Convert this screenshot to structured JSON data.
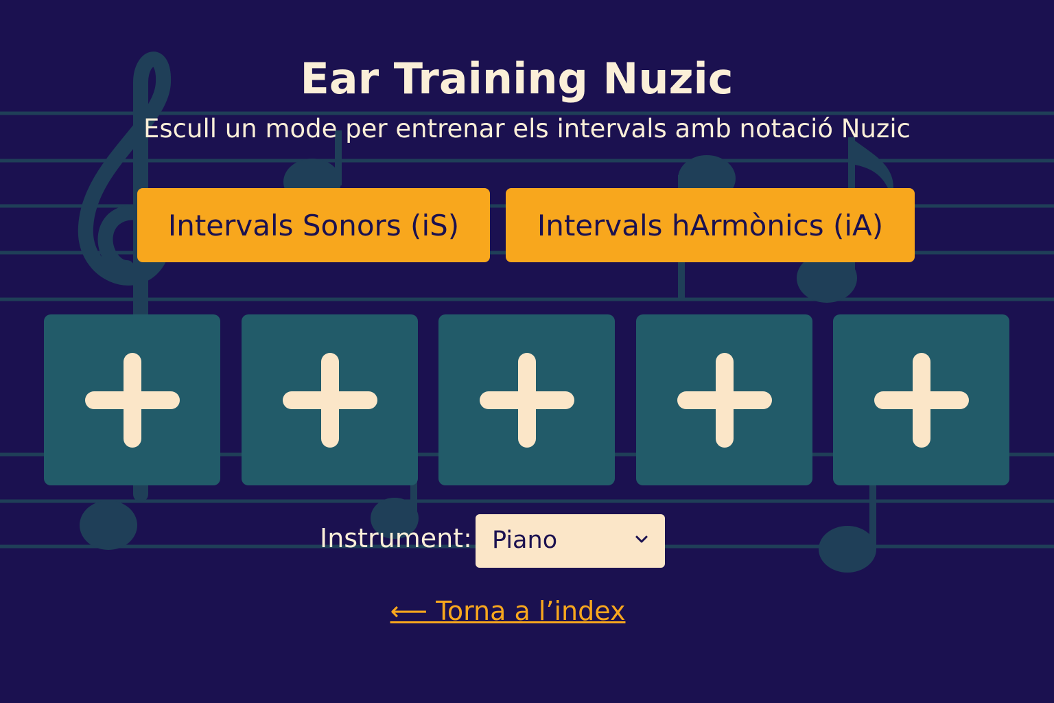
{
  "header": {
    "title": "Ear Training Nuzic",
    "subtitle": "Escull un mode per entrenar els intervals amb notació Nuzic"
  },
  "modes": [
    {
      "label": "Intervals Sonors (iS)"
    },
    {
      "label": "Intervals hArmònics (iA)"
    }
  ],
  "cards": [
    {
      "icon": "plus-icon"
    },
    {
      "icon": "plus-icon"
    },
    {
      "icon": "plus-icon"
    },
    {
      "icon": "plus-icon"
    },
    {
      "icon": "plus-icon"
    }
  ],
  "instrument": {
    "label": "Instrument:",
    "selected": "Piano"
  },
  "nav": {
    "back_label": "⟵ Torna a l’index"
  },
  "colors": {
    "background": "#1b1150",
    "accent": "#f8a71d",
    "card": "#225b69",
    "text": "#fbefd8"
  }
}
